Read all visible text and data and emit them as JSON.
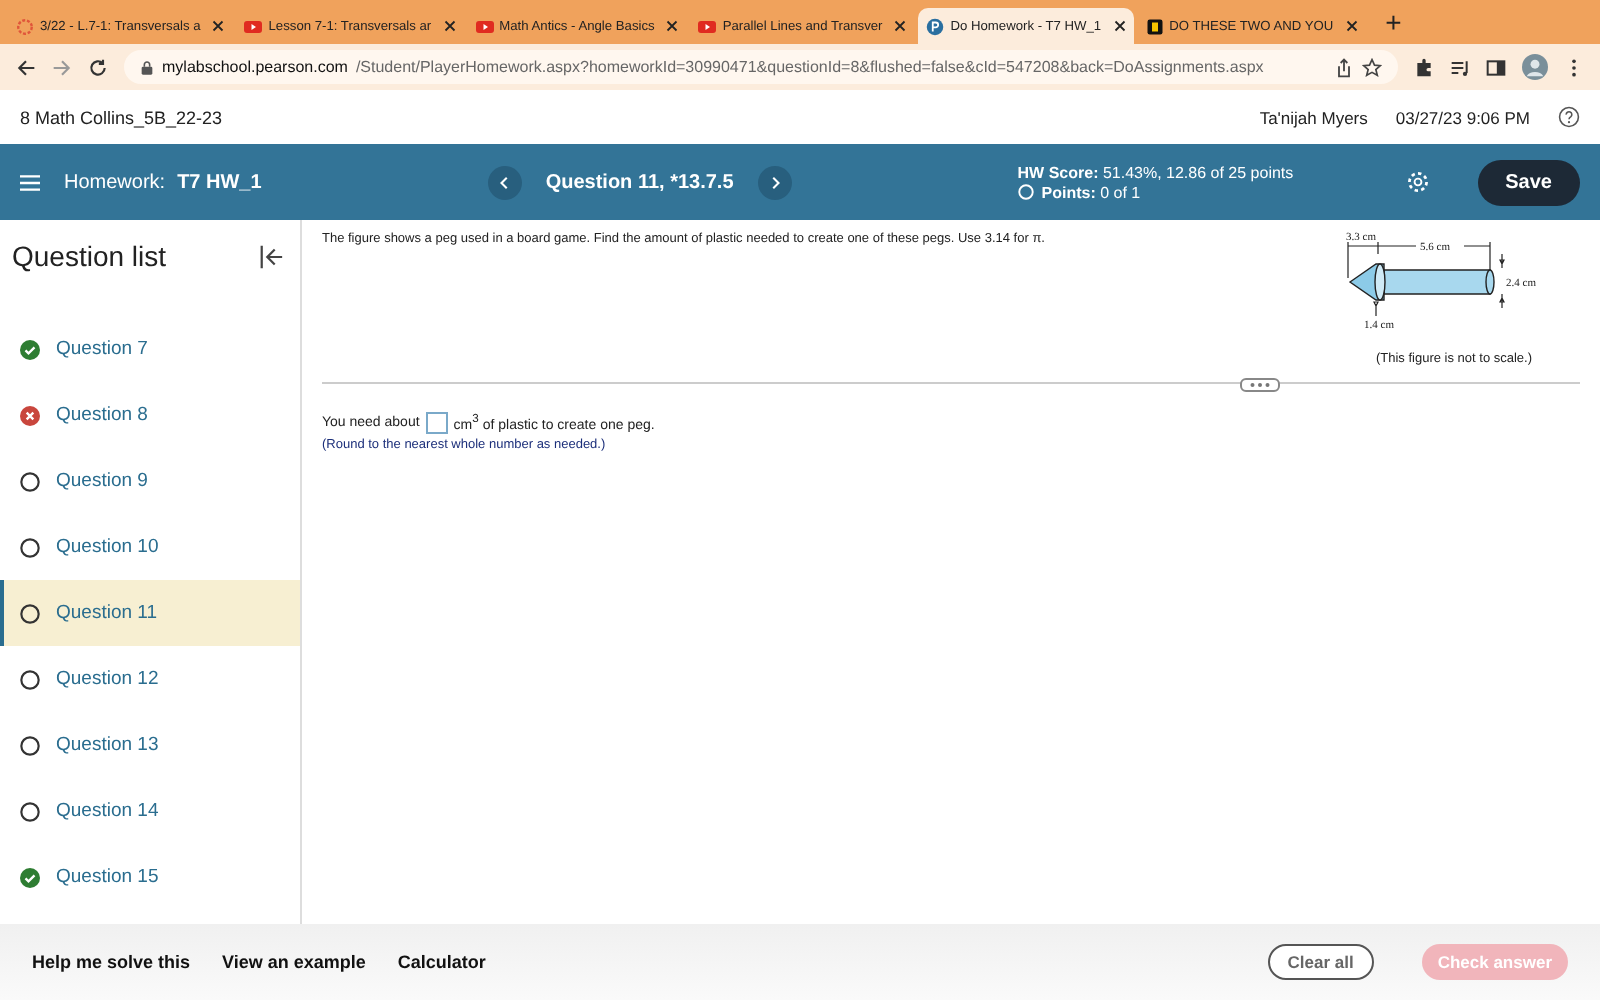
{
  "browser": {
    "tabs": [
      {
        "kind": "activity",
        "title": "3/22 - L.7-1: Transversals a",
        "selected": false
      },
      {
        "kind": "video",
        "title": "Lesson 7-1: Transversals ar",
        "selected": false
      },
      {
        "kind": "video",
        "title": "Math Antics - Angle Basics",
        "selected": false
      },
      {
        "kind": "video",
        "title": "Parallel Lines and Transver",
        "selected": false
      },
      {
        "kind": "pearson",
        "title": "Do Homework - T7 HW_1",
        "selected": true
      },
      {
        "kind": "dark",
        "title": "DO THESE TWO AND YOU",
        "selected": false
      }
    ],
    "new_tab": "+",
    "url_host": "mylabschool.pearson.com",
    "url_path": "/Student/PlayerHomework.aspx?homeworkId=30990471&questionId=8&flushed=false&cId=547208&back=DoAssignments.aspx"
  },
  "header": {
    "course": "8 Math Collins_5B_22-23",
    "user": "Ta'nijah Myers",
    "datetime": "03/27/23 9:06 PM"
  },
  "toolbar": {
    "homework_label": "Homework:",
    "homework_name": "T7 HW_1",
    "question": "Question 11, *13.7.5",
    "hw_score": "**HW Score:** 51.43%, 12.86 of 25 points",
    "points": "**Points:** 0 of 1",
    "save": "Save"
  },
  "sidebar": {
    "title": "Question list",
    "items": [
      {
        "label": "Question 7",
        "kind": "correct",
        "selected": false
      },
      {
        "label": "Question 8",
        "kind": "incorrect",
        "selected": false
      },
      {
        "label": "Question 9",
        "kind": "unanswered",
        "selected": false
      },
      {
        "label": "Question 10",
        "kind": "unanswered",
        "selected": false
      },
      {
        "label": "Question 11",
        "kind": "unanswered",
        "selected": true
      },
      {
        "label": "Question 12",
        "kind": "unanswered",
        "selected": false
      },
      {
        "label": "Question 13",
        "kind": "unanswered",
        "selected": false
      },
      {
        "label": "Question 14",
        "kind": "unanswered",
        "selected": false
      },
      {
        "label": "Question 15",
        "kind": "correct",
        "selected": false
      }
    ]
  },
  "question": {
    "prompt": "The figure shows a peg used in a board game. Find the amount of plastic needed to create one of these pegs. Use 3.14 for π.",
    "figure": {
      "label_left": "3.3 cm",
      "label_top": "5.6 cm",
      "label_right": "2.4 cm",
      "label_bottom": "1.4 cm",
      "caption": "(This figure is not to scale.)"
    },
    "answer_before": "You need about",
    "answer_unit": "cm$^{3}$ of plastic to create one peg.",
    "hint": "(Round to the nearest whole number as needed.)"
  },
  "footer": {
    "links": [
      "Help me solve this",
      "View an example",
      "Calculator"
    ],
    "clear": "Clear all",
    "check": "Check answer",
    "check_disabled": true
  }
}
